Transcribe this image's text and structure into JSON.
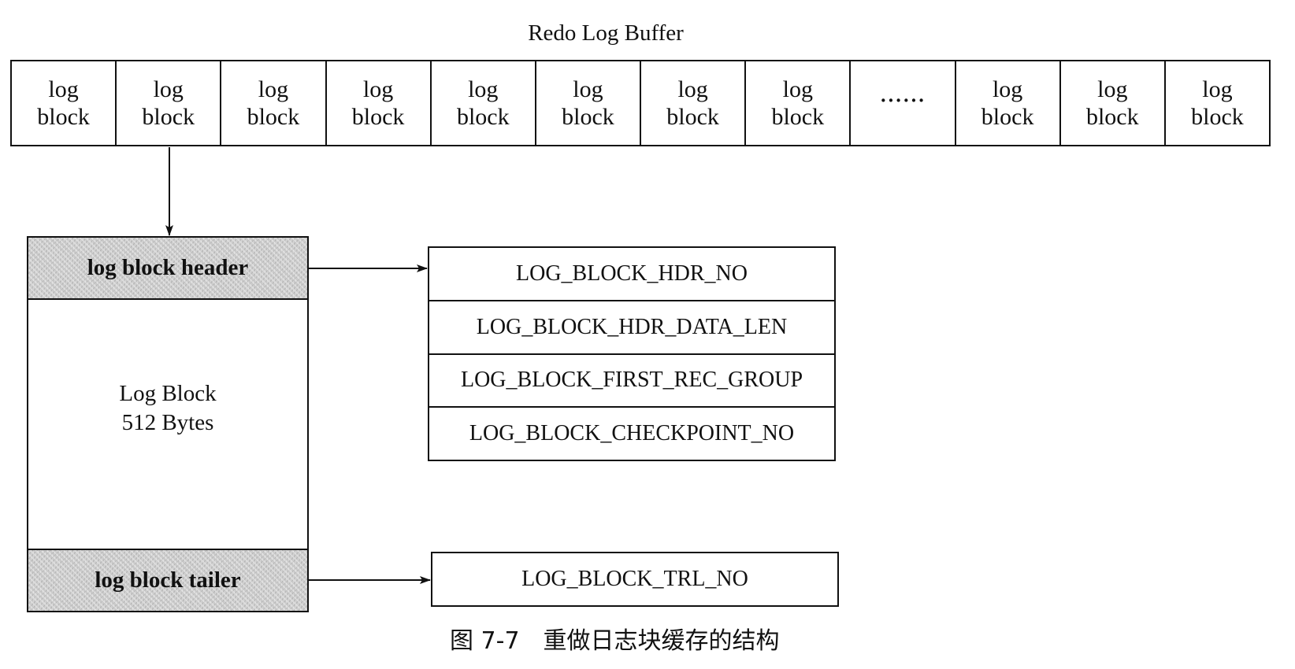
{
  "diagram": {
    "title": "Redo Log Buffer",
    "buffer_cells": [
      {
        "line1": "log",
        "line2": "block"
      },
      {
        "line1": "log",
        "line2": "block"
      },
      {
        "line1": "log",
        "line2": "block"
      },
      {
        "line1": "log",
        "line2": "block"
      },
      {
        "line1": "log",
        "line2": "block"
      },
      {
        "line1": "log",
        "line2": "block"
      },
      {
        "line1": "log",
        "line2": "block"
      },
      {
        "line1": "log",
        "line2": "block"
      },
      {
        "ellipsis": "······"
      },
      {
        "line1": "log",
        "line2": "block"
      },
      {
        "line1": "log",
        "line2": "block"
      },
      {
        "line1": "log",
        "line2": "block"
      }
    ],
    "log_block": {
      "header_label": "log block header",
      "body_line1": "Log Block",
      "body_line2": "512 Bytes",
      "tailer_label": "log block tailer"
    },
    "header_fields": [
      "LOG_BLOCK_HDR_NO",
      "LOG_BLOCK_HDR_DATA_LEN",
      "LOG_BLOCK_FIRST_REC_GROUP",
      "LOG_BLOCK_CHECKPOINT_NO"
    ],
    "tailer_fields": [
      "LOG_BLOCK_TRL_NO"
    ],
    "caption": "图 7-7　重做日志块缓存的结构",
    "colors": {
      "line": "#111111",
      "shading": "#c9c9c9",
      "background": "#ffffff"
    }
  }
}
